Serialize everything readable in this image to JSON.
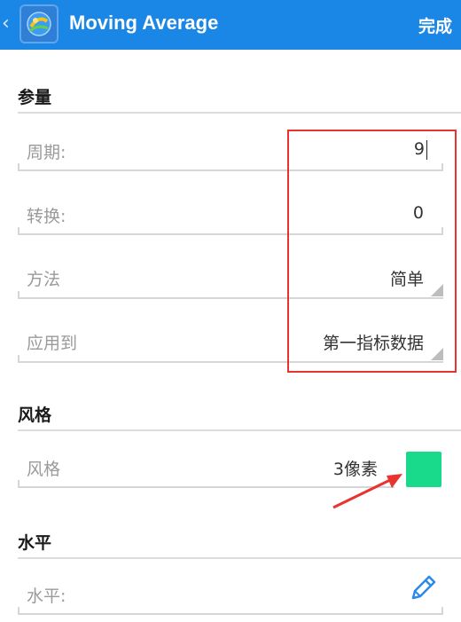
{
  "topbar": {
    "back_glyph": "‹",
    "title": "Moving Average",
    "done_label": "完成"
  },
  "sections": {
    "parameters": {
      "header": "参量",
      "period_label": "周期:",
      "period_value": "9",
      "shift_label": "转换:",
      "shift_value": "0",
      "method_label": "方法",
      "method_value": "简单",
      "apply_label": "应用到",
      "apply_value": "第一指标数据"
    },
    "style": {
      "header": "风格",
      "style_label": "风格",
      "style_value": "3像素",
      "color": "#19d98a"
    },
    "levels": {
      "header": "水平",
      "level_label": "水平:"
    }
  },
  "annotations": {
    "highlight_color": "#e8332e",
    "arrow_color": "#e8332e"
  },
  "colors": {
    "accent": "#1a86e6"
  }
}
